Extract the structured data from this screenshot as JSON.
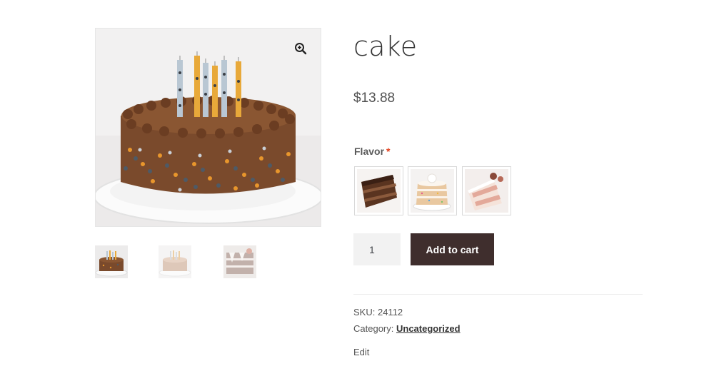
{
  "product": {
    "title": "cake",
    "price": "$13.88"
  },
  "gallery": {
    "zoom_icon": "zoom-in-icon",
    "thumbnails": [
      "chocolate birthday cake",
      "vanilla cake",
      "layered slice cake"
    ]
  },
  "variation": {
    "label": "Flavor",
    "required_mark": "*",
    "swatches": [
      "chocolate",
      "funfetti",
      "strawberry"
    ]
  },
  "cart": {
    "quantity": "1",
    "add_label": "Add to cart"
  },
  "meta": {
    "sku_label": "SKU:",
    "sku_value": "24112",
    "category_label": "Category:",
    "category_value": "Uncategorized",
    "edit_label": "Edit"
  },
  "colors": {
    "button_bg": "#3f2e2d",
    "required": "#e2401c"
  }
}
